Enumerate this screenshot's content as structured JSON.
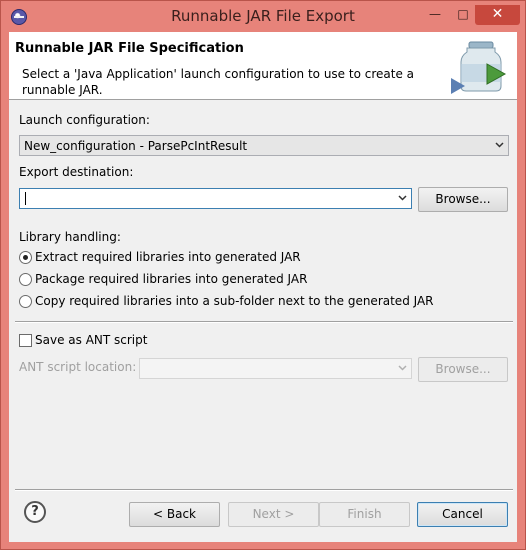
{
  "window": {
    "title": "Runnable JAR File Export"
  },
  "header": {
    "title": "Runnable JAR File Specification",
    "description": "Select a 'Java Application' launch configuration to use to create a runnable JAR."
  },
  "launch": {
    "label": "Launch configuration:",
    "value": "New_configuration - ParsePcIntResult"
  },
  "export": {
    "label": "Export destination:",
    "value": "",
    "browse": "Browse..."
  },
  "library": {
    "label": "Library handling:",
    "options": [
      {
        "label": "Extract required libraries into generated JAR",
        "selected": true
      },
      {
        "label": "Package required libraries into generated JAR",
        "selected": false
      },
      {
        "label": "Copy required libraries into a sub-folder next to the generated JAR",
        "selected": false
      }
    ]
  },
  "ant": {
    "checkbox_label": "Save as ANT script",
    "checked": false,
    "location_label": "ANT script location:",
    "value": "",
    "browse": "Browse..."
  },
  "buttons": {
    "help": "?",
    "back": "< Back",
    "next": "Next >",
    "finish": "Finish",
    "cancel": "Cancel"
  }
}
